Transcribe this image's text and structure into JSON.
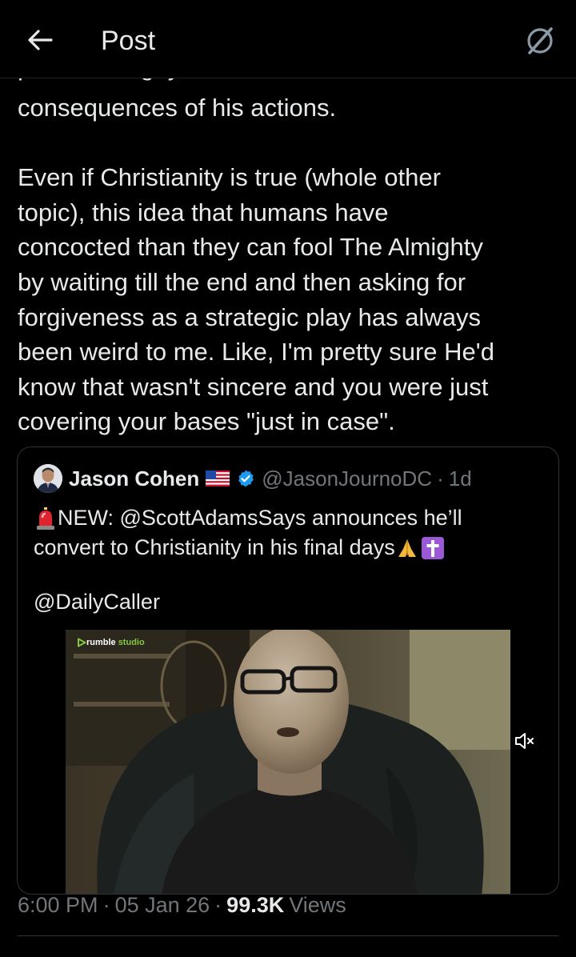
{
  "header": {
    "title": "Post"
  },
  "post": {
    "cut_line": "pro-MAGA guy didn't have to face the",
    "first_line": "consequences of his actions.",
    "paragraph2": [
      "Even if Christianity is true (whole other",
      "topic), this idea that humans have",
      "concocted than they can fool The Almighty",
      "by waiting till the end and then asking for",
      "forgiveness as a strategic play has always",
      "been weird to me.  Like, I'm pretty sure He'd",
      "know that wasn't sincere and you were just",
      "covering your bases \"just in case\"."
    ]
  },
  "quote": {
    "author_name": "Jason Cohen",
    "handle": "@JasonJournoDC",
    "dot": "·",
    "time": "1d",
    "text_line1": "NEW: @ScottAdamsSays announces he’ll",
    "text_line2": "convert to Christianity in his final days",
    "mention": "@DailyCaller",
    "video": {
      "brand": "rumble",
      "brand_sub": "studio",
      "muted": true
    }
  },
  "meta": {
    "time": "6:00 PM",
    "dot1": "·",
    "date": "05 Jan 26",
    "dot2": "·",
    "views_count": "99.3K",
    "views_label": "Views"
  },
  "colors": {
    "background": "#000000",
    "text": "#e7e9ea",
    "muted": "#71767b",
    "border": "#2f3336",
    "verified": "#1d9bf0"
  },
  "icons": {
    "back": "arrow-left-icon",
    "grok": "grok-icon",
    "verified": "verified-badge-icon",
    "flag": "us-flag-icon",
    "siren": "siren-emoji-icon",
    "pray": "folded-hands-emoji-icon",
    "cross": "latin-cross-emoji-icon",
    "mute": "speaker-muted-icon"
  }
}
